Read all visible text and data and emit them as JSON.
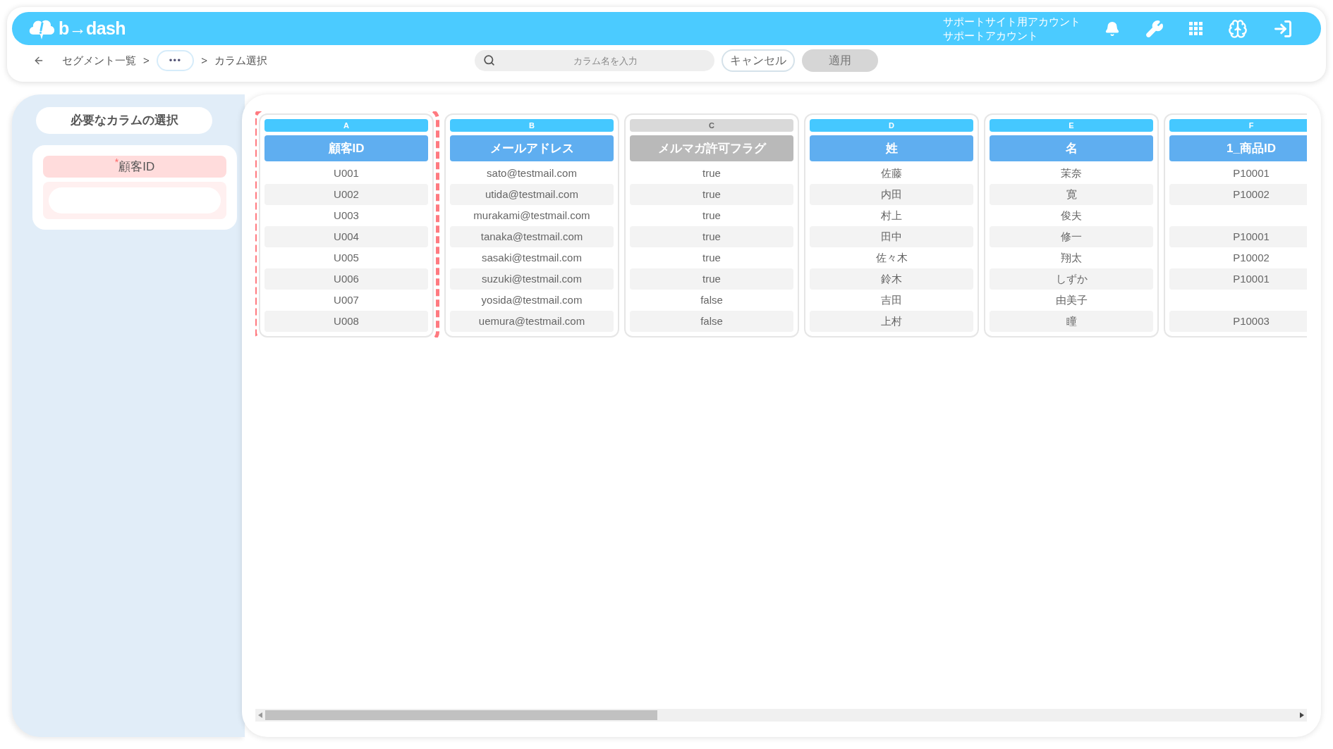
{
  "header": {
    "logo": "b→dash",
    "account": [
      "サポートサイト用アカウント",
      "サポートアカウント"
    ]
  },
  "breadcrumb": {
    "items": [
      "セグメント一覧",
      ">",
      "•••",
      ">",
      "カラム選択"
    ]
  },
  "search": {
    "placeholder": "カラム名を入力"
  },
  "buttons": [
    {
      "label": "キャンセル",
      "disabled": false
    },
    {
      "label": "適用",
      "disabled": true
    }
  ],
  "sidebar": {
    "title": "必要なカラムの選択",
    "fields": [
      {
        "label": "$^{*}$顧客ID"
      }
    ]
  },
  "columns": [
    {
      "letter": "A",
      "name": "顧客ID",
      "enabled": true,
      "selected": true,
      "cells": [
        "U001",
        "U002",
        "U003",
        "U004",
        "U005",
        "U006",
        "U007",
        "U008"
      ]
    },
    {
      "letter": "B",
      "name": "メールアドレス",
      "enabled": true,
      "selected": false,
      "cells": [
        "sato@testmail.com",
        "utida@testmail.com",
        "murakami@testmail.com",
        "tanaka@testmail.com",
        "sasaki@testmail.com",
        "suzuki@testmail.com",
        "yosida@testmail.com",
        "uemura@testmail.com"
      ]
    },
    {
      "letter": "C",
      "name": "メルマガ許可フラグ",
      "enabled": false,
      "selected": false,
      "cells": [
        "true",
        "true",
        "true",
        "true",
        "true",
        "true",
        "false",
        "false"
      ]
    },
    {
      "letter": "D",
      "name": "姓",
      "enabled": true,
      "selected": false,
      "cells": [
        "佐藤",
        "内田",
        "村上",
        "田中",
        "佐々木",
        "鈴木",
        "吉田",
        "上村"
      ]
    },
    {
      "letter": "E",
      "name": "名",
      "enabled": true,
      "selected": false,
      "cells": [
        "茉奈",
        "寛",
        "俊夫",
        "修一",
        "翔太",
        "しずか",
        "由美子",
        "瞳"
      ]
    },
    {
      "letter": "F",
      "name": "1_商品ID",
      "enabled": true,
      "selected": false,
      "cells": [
        "P10001",
        "P10002",
        null,
        "P10001",
        "P10002",
        "P10001",
        null,
        "P10003"
      ]
    }
  ]
}
